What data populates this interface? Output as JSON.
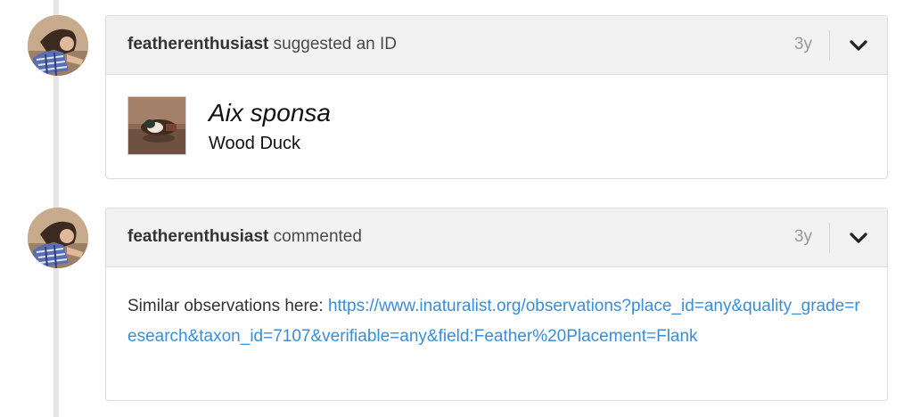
{
  "activities": [
    {
      "user": "featherenthusiast",
      "action": "suggested an ID",
      "time": "3y",
      "taxon": {
        "scientific_name": "Aix sponsa",
        "common_name": "Wood Duck"
      }
    },
    {
      "user": "featherenthusiast",
      "action": "commented",
      "time": "3y",
      "comment": {
        "text": "Similar observations here: ",
        "link": "https://www.inaturalist.org/observations?place_id=any&quality_grade=research&taxon_id=7107&verifiable=any&field:Feather%20Placement=Flank"
      }
    }
  ],
  "icons": {
    "menu_toggle": "chevron-down-icon",
    "avatar": "user-avatar-photo",
    "taxon_photo": "wood-duck-photo"
  },
  "colors": {
    "link": "#3b8dd5",
    "header_bg": "#f2f2f2",
    "timeline": "#e5e5e5",
    "muted": "#999999"
  }
}
